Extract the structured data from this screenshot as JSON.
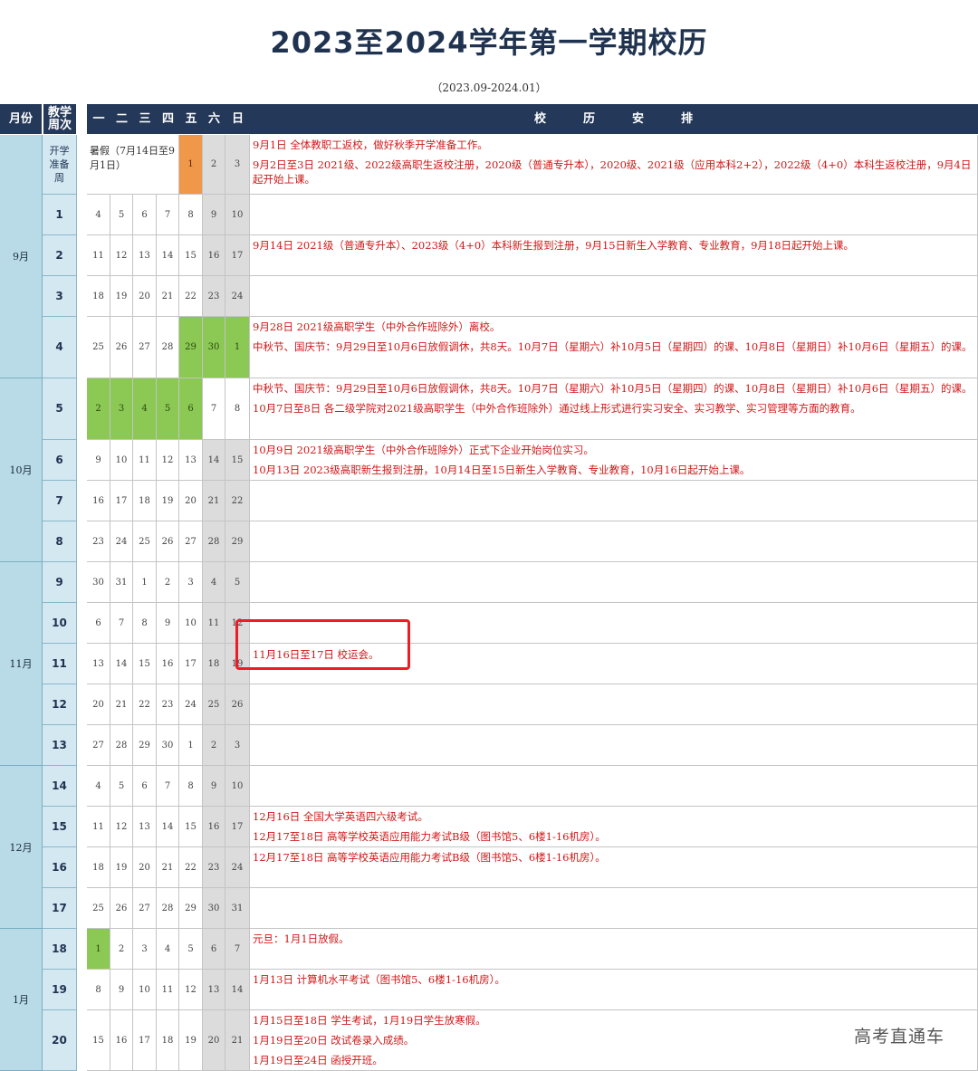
{
  "title": "2023至2024学年第一学期校历",
  "subtitle": "（2023.09-2024.01）",
  "header": {
    "month": "月份",
    "week": "教学周次",
    "days": [
      "一",
      "二",
      "三",
      "四",
      "五",
      "六",
      "日"
    ],
    "schedule": [
      "校",
      "历",
      "安",
      "排"
    ]
  },
  "months": [
    {
      "label": "9月",
      "rows": [
        0,
        4
      ]
    },
    {
      "label": "10月",
      "rows": [
        5,
        8
      ]
    },
    {
      "label": "11月",
      "rows": [
        9,
        13
      ]
    },
    {
      "label": "12月",
      "rows": [
        14,
        17
      ]
    },
    {
      "label": "1月",
      "rows": [
        18,
        20
      ]
    }
  ],
  "summer_note": "暑假（7月14日至9月1日）",
  "rows": [
    {
      "week": "开学准备周",
      "days": [
        "",
        "",
        "",
        "",
        "1",
        "2",
        "3"
      ],
      "colors": [
        "",
        "",
        "",
        "",
        "orange",
        "wknd",
        "wknd"
      ],
      "notes": [
        "9月1日 全体教职工返校，做好秋季开学准备工作。",
        "9月2日至3日 2021级、2022级高职生返校注册，2020级（普通专升本），2020级、2021级（应用本科2+2），2022级（4+0）本科生返校注册，9月4日起开始上课。"
      ]
    },
    {
      "week": "1",
      "days": [
        "4",
        "5",
        "6",
        "7",
        "8",
        "9",
        "10"
      ],
      "colors": [
        "",
        "",
        "",
        "",
        "",
        "wknd",
        "wknd"
      ],
      "notes": []
    },
    {
      "week": "2",
      "days": [
        "11",
        "12",
        "13",
        "14",
        "15",
        "16",
        "17"
      ],
      "colors": [
        "",
        "",
        "",
        "",
        "",
        "wknd",
        "wknd"
      ],
      "notes": [
        "9月14日 2021级（普通专升本）、2023级（4+0）本科新生报到注册，9月15日新生入学教育、专业教育，9月18日起开始上课。"
      ]
    },
    {
      "week": "3",
      "days": [
        "18",
        "19",
        "20",
        "21",
        "22",
        "23",
        "24"
      ],
      "colors": [
        "",
        "",
        "",
        "",
        "",
        "wknd",
        "wknd"
      ],
      "notes": []
    },
    {
      "week": "4",
      "days": [
        "25",
        "26",
        "27",
        "28",
        "29",
        "30",
        "1"
      ],
      "colors": [
        "",
        "",
        "",
        "",
        "green",
        "green",
        "green"
      ],
      "notes": [
        "9月28日 2021级高职学生（中外合作班除外）离校。",
        "中秋节、国庆节：9月29日至10月6日放假调休，共8天。10月7日（星期六）补10月5日（星期四）的课、10月8日（星期日）补10月6日（星期五）的课。"
      ]
    },
    {
      "week": "5",
      "days": [
        "2",
        "3",
        "4",
        "5",
        "6",
        "7",
        "8"
      ],
      "colors": [
        "green",
        "green",
        "green",
        "green",
        "green",
        "",
        ""
      ],
      "notes": [
        "中秋节、国庆节：9月29日至10月6日放假调休，共8天。10月7日（星期六）补10月5日（星期四）的课、10月8日（星期日）补10月6日（星期五）的课。",
        "10月7日至8日 各二级学院对2021级高职学生（中外合作班除外）通过线上形式进行实习安全、实习教学、实习管理等方面的教育。"
      ]
    },
    {
      "week": "6",
      "days": [
        "9",
        "10",
        "11",
        "12",
        "13",
        "14",
        "15"
      ],
      "colors": [
        "",
        "",
        "",
        "",
        "",
        "wknd",
        "wknd"
      ],
      "notes": [
        "10月9日 2021级高职学生（中外合作班除外）正式下企业开始岗位实习。",
        "10月13日 2023级高职新生报到注册，10月14日至15日新生入学教育、专业教育，10月16日起开始上课。"
      ]
    },
    {
      "week": "7",
      "days": [
        "16",
        "17",
        "18",
        "19",
        "20",
        "21",
        "22"
      ],
      "colors": [
        "",
        "",
        "",
        "",
        "",
        "wknd",
        "wknd"
      ],
      "notes": []
    },
    {
      "week": "8",
      "days": [
        "23",
        "24",
        "25",
        "26",
        "27",
        "28",
        "29"
      ],
      "colors": [
        "",
        "",
        "",
        "",
        "",
        "wknd",
        "wknd"
      ],
      "notes": []
    },
    {
      "week": "9",
      "days": [
        "30",
        "31",
        "1",
        "2",
        "3",
        "4",
        "5"
      ],
      "colors": [
        "",
        "",
        "",
        "",
        "",
        "wknd",
        "wknd"
      ],
      "notes": []
    },
    {
      "week": "10",
      "days": [
        "6",
        "7",
        "8",
        "9",
        "10",
        "11",
        "12"
      ],
      "colors": [
        "",
        "",
        "",
        "",
        "",
        "wknd",
        "wknd"
      ],
      "notes": []
    },
    {
      "week": "11",
      "days": [
        "13",
        "14",
        "15",
        "16",
        "17",
        "18",
        "19"
      ],
      "colors": [
        "",
        "",
        "",
        "",
        "",
        "wknd",
        "wknd"
      ],
      "notes": [
        "11月16日至17日 校运会。"
      ]
    },
    {
      "week": "12",
      "days": [
        "20",
        "21",
        "22",
        "23",
        "24",
        "25",
        "26"
      ],
      "colors": [
        "",
        "",
        "",
        "",
        "",
        "wknd",
        "wknd"
      ],
      "notes": []
    },
    {
      "week": "13",
      "days": [
        "27",
        "28",
        "29",
        "30",
        "1",
        "2",
        "3"
      ],
      "colors": [
        "",
        "",
        "",
        "",
        "",
        "wknd",
        "wknd"
      ],
      "notes": []
    },
    {
      "week": "14",
      "days": [
        "4",
        "5",
        "6",
        "7",
        "8",
        "9",
        "10"
      ],
      "colors": [
        "",
        "",
        "",
        "",
        "",
        "wknd",
        "wknd"
      ],
      "notes": []
    },
    {
      "week": "15",
      "days": [
        "11",
        "12",
        "13",
        "14",
        "15",
        "16",
        "17"
      ],
      "colors": [
        "",
        "",
        "",
        "",
        "",
        "wknd",
        "wknd"
      ],
      "notes": [
        "12月16日 全国大学英语四六级考试。",
        "12月17至18日 高等学校英语应用能力考试B级（图书馆5、6楼1-16机房）。"
      ]
    },
    {
      "week": "16",
      "days": [
        "18",
        "19",
        "20",
        "21",
        "22",
        "23",
        "24"
      ],
      "colors": [
        "",
        "",
        "",
        "",
        "",
        "wknd",
        "wknd"
      ],
      "notes": [
        "12月17至18日 高等学校英语应用能力考试B级（图书馆5、6楼1-16机房）。"
      ]
    },
    {
      "week": "17",
      "days": [
        "25",
        "26",
        "27",
        "28",
        "29",
        "30",
        "31"
      ],
      "colors": [
        "",
        "",
        "",
        "",
        "",
        "wknd",
        "wknd"
      ],
      "notes": []
    },
    {
      "week": "18",
      "days": [
        "1",
        "2",
        "3",
        "4",
        "5",
        "6",
        "7"
      ],
      "colors": [
        "green",
        "",
        "",
        "",
        "",
        "wknd",
        "wknd"
      ],
      "notes": [
        "元旦：1月1日放假。"
      ]
    },
    {
      "week": "19",
      "days": [
        "8",
        "9",
        "10",
        "11",
        "12",
        "13",
        "14"
      ],
      "colors": [
        "",
        "",
        "",
        "",
        "",
        "wknd",
        "wknd"
      ],
      "notes": [
        "1月13日 计算机水平考试（图书馆5、6楼1-16机房）。"
      ]
    },
    {
      "week": "20",
      "days": [
        "15",
        "16",
        "17",
        "18",
        "19",
        "20",
        "21"
      ],
      "colors": [
        "",
        "",
        "",
        "",
        "",
        "wknd",
        "wknd"
      ],
      "notes": [
        "1月15日至18日 学生考试，1月19日学生放寒假。",
        "1月19日至20日 改试卷录入成绩。",
        "1月19日至24日 函授开班。"
      ]
    }
  ],
  "watermark": "高考直通车",
  "colors": {
    "header": "#24395a",
    "month": "#b9dbe8",
    "week": "#d3e8f1",
    "weekend": "#dcdcdc",
    "holiday": "#8cc854",
    "start": "#f0984a",
    "note": "#d01818"
  }
}
